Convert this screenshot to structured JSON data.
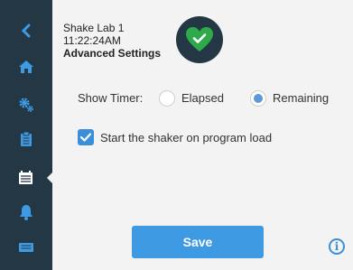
{
  "header": {
    "device_name": "Shake Lab 1",
    "time": "11:22:24AM",
    "page_title": "Advanced Settings"
  },
  "status": {
    "icon": "heart-check-icon",
    "state": "ok",
    "color": "#2faa4a"
  },
  "sidebar": {
    "items": [
      {
        "icon": "back-chevron-icon"
      },
      {
        "icon": "home-icon"
      },
      {
        "icon": "settings-gears-icon"
      },
      {
        "icon": "clipboard-icon"
      },
      {
        "icon": "calendar-list-icon",
        "active": true
      },
      {
        "icon": "bell-icon"
      },
      {
        "icon": "display-icon"
      }
    ]
  },
  "timer": {
    "label": "Show Timer:",
    "options": [
      {
        "label": "Elapsed",
        "selected": false
      },
      {
        "label": "Remaining",
        "selected": true
      }
    ]
  },
  "shaker_option": {
    "label": "Start the shaker on program load",
    "checked": true
  },
  "save_label": "Save",
  "info_icon": "info-icon",
  "colors": {
    "sidebar": "#243745",
    "accent": "#3f9ae4",
    "background": "#f3f3f3"
  }
}
